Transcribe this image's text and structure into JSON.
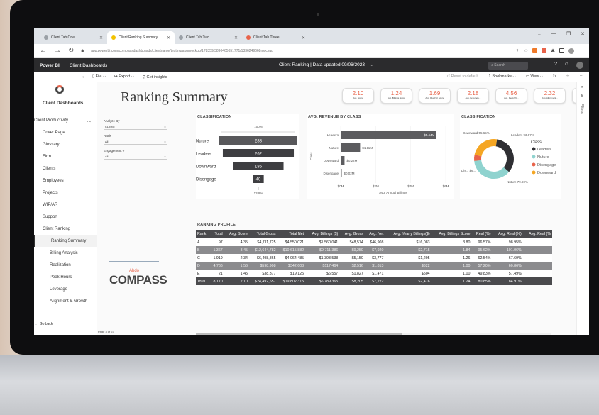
{
  "browser": {
    "tabs": [
      {
        "label": "Client Tab One",
        "color": "#9aa0a6",
        "active": false
      },
      {
        "label": "Client Ranking Summary",
        "color": "#f2c200",
        "active": true
      },
      {
        "label": "Client Tab Two",
        "color": "#9aa0a6",
        "active": false
      },
      {
        "label": "Client Tab Three",
        "color": "#e8634a",
        "active": false
      }
    ],
    "url": "app.powerbi.com/compassdashboards/clientname/testing/appmockup/178359/3890465651771/1336249668mockup",
    "new_tab": "+"
  },
  "pbi": {
    "brand": "Power BI",
    "workspace": "Client Dashboards",
    "report_header": "Client Ranking  |  Data updated 09/06/2023",
    "search_placeholder": "Search",
    "toolbar": {
      "file": "File",
      "export": "Export",
      "insights": "Get insights",
      "reset": "Reset to default",
      "bookmarks": "Bookmarks",
      "view": "View"
    },
    "filters_tab": "Filters"
  },
  "nav": {
    "title": "Client Dashboards",
    "group": "Client Productivity",
    "items": [
      "Cover Page",
      "Glossary",
      "Firm",
      "Clients",
      "Employees",
      "Projects",
      "WIP/AR",
      "Support",
      "Client Ranking"
    ],
    "subitems": [
      "Ranking Summary",
      "Billing Analysis",
      "Realization",
      "Peak Hours",
      "Leverage",
      "Alignment & Growth"
    ],
    "active": "Ranking Summary",
    "go_back": "Go back"
  },
  "report": {
    "title": "Ranking Summary",
    "kpis": [
      {
        "value": "2.10",
        "label": "Avg. Score"
      },
      {
        "value": "1.24",
        "label": "Avg. Billings Score"
      },
      {
        "value": "1.69",
        "label": "Avg. Real(%) Score"
      },
      {
        "value": "2.18",
        "label": "Avg. Leverage..."
      },
      {
        "value": "4.56",
        "label": "Avg. Peak(%)..."
      },
      {
        "value": "2.32",
        "label": "Avg. Alignment..."
      },
      {
        "value": "4.00",
        "label": "Avg. Growth Score"
      }
    ],
    "filters": [
      {
        "label": "Analyze By",
        "value": "CLIENT"
      },
      {
        "label": "Rank",
        "value": "All"
      },
      {
        "label": "Engagement #",
        "value": "All"
      }
    ],
    "logo": {
      "small": "Abdo",
      "word": "COMPASS"
    },
    "page_info": "Page 3 of 23"
  },
  "funnel": {
    "title": "CLASSIFICATION",
    "top_pct": "100%",
    "bottom_pct": "13.9%",
    "rows": [
      {
        "label": "Nuture",
        "value": 288
      },
      {
        "label": "Leaders",
        "value": 262
      },
      {
        "label": "Downward",
        "value": 186
      },
      {
        "label": "Disengage",
        "value": 40
      }
    ]
  },
  "revenue": {
    "title": "AVG. REVENUE BY CLASS",
    "yaxis": "Class",
    "xaxis": "Avg. Annual Billings",
    "ticks": [
      "$0M",
      "$2M",
      "$4M",
      "$6M"
    ],
    "max": 6,
    "rows": [
      {
        "label": "Leaders",
        "value": 5.44,
        "text": "$5.44M"
      },
      {
        "label": "Nuture",
        "value": 1.11,
        "text": "$1.11M"
      },
      {
        "label": "Downward",
        "value": 0.22,
        "text": "$0.22M"
      },
      {
        "label": "Disengage",
        "value": 0.02,
        "text": "$0.02M"
      }
    ]
  },
  "donut": {
    "title": "CLASSIFICATION",
    "legend_title": "Class",
    "labels": {
      "downward": "Downward 55.65%",
      "leaders": "Leaders 93.07%",
      "dis": "Dis... $6...",
      "nuture": "Nuture 79.69%"
    },
    "segments": [
      {
        "name": "Leaders",
        "value": 34,
        "color": "#2f2f33"
      },
      {
        "name": "Nuture",
        "value": 37,
        "color": "#8fd3cf"
      },
      {
        "name": "Disengage",
        "value": 5,
        "color": "#e8634a"
      },
      {
        "name": "Downward",
        "value": 24,
        "color": "#f5a623"
      }
    ]
  },
  "ranking": {
    "title": "RANKING PROFILE",
    "columns": [
      "Rank",
      "Total",
      "Avg. Score",
      "Total Gross",
      "Total Net",
      "Avg. Billings ($)",
      "Avg. Gross",
      "Avg. Net",
      "Avg. Yearly Billings($)",
      "Avg. Billings Score",
      "Real (%)",
      "Avg. Real (%)",
      "Avg. Real (%"
    ],
    "rows": [
      [
        "A",
        "97",
        "4.35",
        "$4,711,725",
        "$4,550,021",
        "$1,560,041",
        "$48,574",
        "$46,908",
        "$16,083",
        "3.80",
        "96.57%",
        "98.95%",
        ""
      ],
      [
        "B",
        "1,367",
        "3.45",
        "$12,644,782",
        "$10,615,882",
        "$9,711,386",
        "$9,250",
        "$7,920",
        "$2,715",
        "1.84",
        "95.62%",
        "101.06%",
        ""
      ],
      [
        "C",
        "1,919",
        "2.34",
        "$6,498,865",
        "$4,064,485",
        "$1,393,538",
        "$5,150",
        "$3,777",
        "$1,295",
        "1.26",
        "62.54%",
        "67.69%",
        ""
      ],
      [
        "D",
        "4,766",
        "1.56",
        "$598,908",
        "$342,603",
        "-$117,464",
        "$2,516",
        "$1,813",
        "$622",
        "1.00",
        "57.20%",
        "60.86%",
        ""
      ],
      [
        "E",
        "21",
        "1.45",
        "$38,377",
        "$19,125",
        "$6,557",
        "$1,827",
        "$1,471",
        "$504",
        "1.00",
        "49.83%",
        "57.49%",
        ""
      ]
    ],
    "total": [
      "Total",
      "8,170",
      "2.10",
      "$24,492,657",
      "$19,802,315",
      "$6,789,365",
      "$8,205",
      "$7,222",
      "$2,476",
      "1.24",
      "80.85%",
      "84.91%",
      ""
    ]
  },
  "pages": [
    "Ranking Summary",
    "Billing Analysis",
    "Realization",
    "Peak Hours",
    "Leverage",
    "Alignment & Growth"
  ]
}
